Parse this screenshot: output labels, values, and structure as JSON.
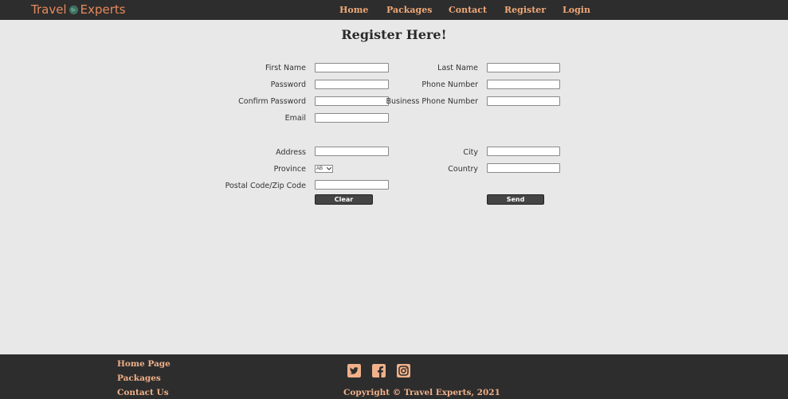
{
  "header": {
    "logo_left": "Travel",
    "logo_right": "Experts",
    "nav": [
      "Home",
      "Packages",
      "Contact",
      "Register",
      "Login"
    ]
  },
  "page": {
    "title": "Register Here!"
  },
  "form": {
    "first_name_label": "First Name",
    "last_name_label": "Last Name",
    "password_label": "Password",
    "phone_label": "Phone Number",
    "confirm_password_label": "Confirm Password",
    "business_phone_label": "Business Phone Number",
    "email_label": "Email",
    "address_label": "Address",
    "city_label": "City",
    "province_label": "Province",
    "country_label": "Country",
    "postal_label": "Postal Code/Zip Code",
    "province_selected": "AB",
    "clear_label": "Clear",
    "send_label": "Send"
  },
  "footer": {
    "links": [
      "Home Page",
      "Packages",
      "Contact Us"
    ],
    "social_icons": [
      "twitter-icon",
      "facebook-icon",
      "instagram-icon"
    ],
    "copyright": "Copyright © Travel Experts, 2021"
  },
  "colors": {
    "header_bg": "#2d2d2d",
    "accent": "#e68a5c",
    "page_bg": "#e8e8e8"
  }
}
